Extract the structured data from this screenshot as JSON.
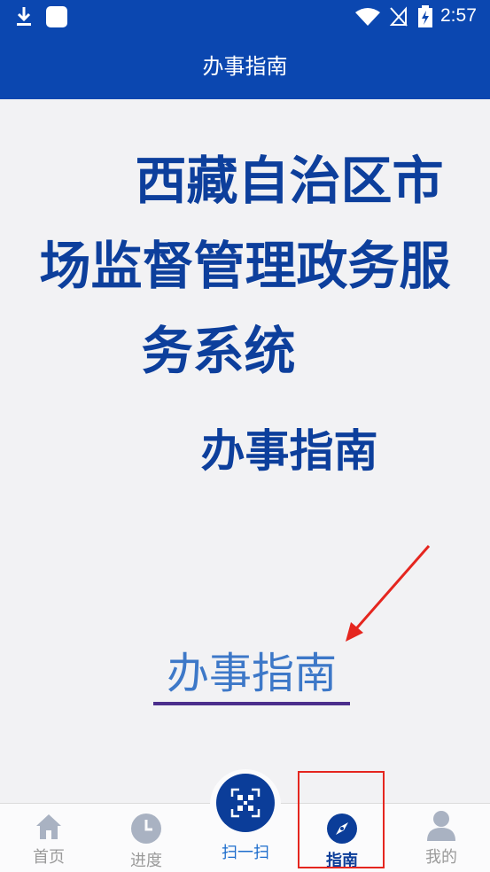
{
  "status_bar": {
    "time": "2:57",
    "icons": [
      "download-icon",
      "app-square-icon",
      "wifi-icon",
      "no-signal-icon",
      "battery-charging-icon"
    ]
  },
  "header": {
    "title": "办事指南"
  },
  "main": {
    "headline_line1": "西藏自治区市",
    "headline_line2": "场监督管理政务服",
    "headline_line3": "务系统",
    "subheadline": "办事指南",
    "link_text": "办事指南"
  },
  "bottom_nav": {
    "items": [
      {
        "label": "首页",
        "icon": "home-icon"
      },
      {
        "label": "进度",
        "icon": "clock-icon"
      },
      {
        "label": "扫一扫",
        "icon": "qr-scan-icon"
      },
      {
        "label": "指南",
        "icon": "compass-icon",
        "active": true
      },
      {
        "label": "我的",
        "icon": "user-icon"
      }
    ]
  },
  "colors": {
    "brand": "#0b47b0",
    "headline": "#0d3f9c",
    "link": "#3d78c8",
    "annotation": "#e5261f"
  }
}
